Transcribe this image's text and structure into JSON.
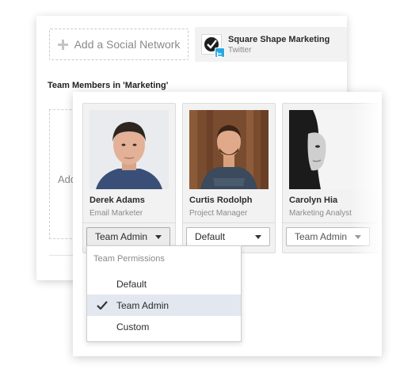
{
  "social": {
    "add_label": "Add a Social Network",
    "account": {
      "name": "Square Shape Marketing",
      "network": "Twitter"
    }
  },
  "team": {
    "title": "Team Members in 'Marketing'",
    "add_label": "Add"
  },
  "members": [
    {
      "name": "Derek Adams",
      "role": "Email Marketer",
      "permission": "Team Admin"
    },
    {
      "name": "Curtis Rodolph",
      "role": "Project Manager",
      "permission": "Default"
    },
    {
      "name": "Carolyn Hia",
      "role": "Marketing Analyst",
      "permission": "Team Admin"
    }
  ],
  "dropdown": {
    "header": "Team Permissions",
    "options": [
      "Default",
      "Team Admin",
      "Custom"
    ],
    "selected": "Team Admin"
  },
  "colors": {
    "twitter": "#29a8e0",
    "selected_row": "#e3e8f0"
  }
}
